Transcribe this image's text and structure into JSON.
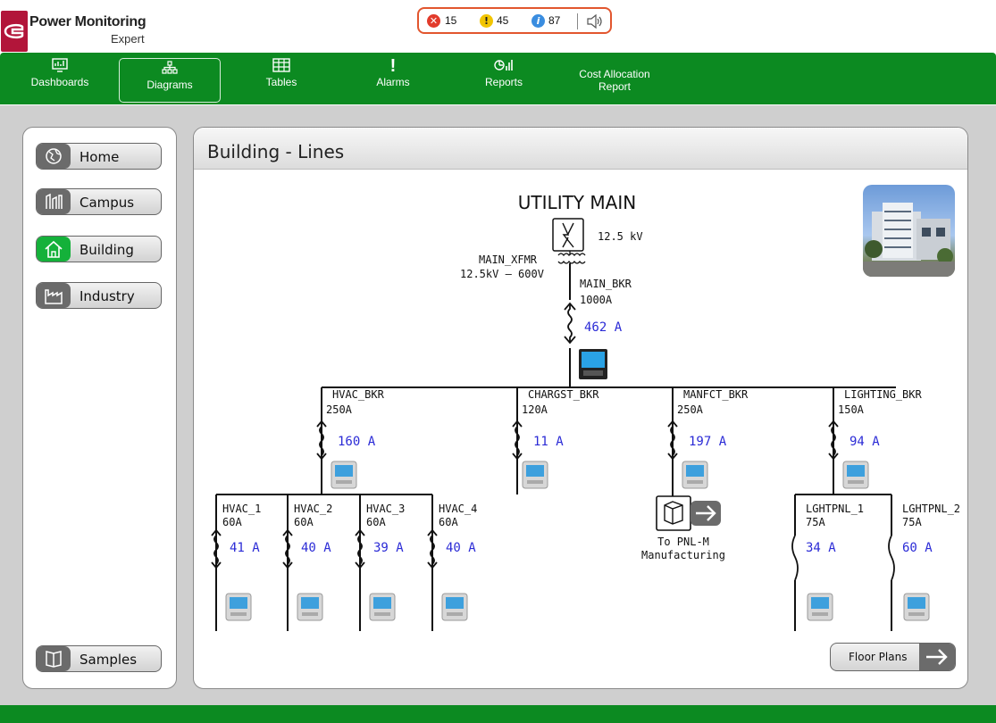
{
  "app": {
    "title": "Power Monitoring",
    "subtitle": "Expert"
  },
  "alarms": {
    "critical": "15",
    "warning": "45",
    "info": "87"
  },
  "nav": {
    "items": [
      {
        "label": "Dashboards",
        "icon": "dashboard-icon"
      },
      {
        "label": "Diagrams",
        "icon": "diagram-icon"
      },
      {
        "label": "Tables",
        "icon": "table-icon"
      },
      {
        "label": "Alarms",
        "icon": "alarm-icon"
      },
      {
        "label": "Reports",
        "icon": "report-icon"
      },
      {
        "label": "Cost Allocation",
        "label2": "Report"
      }
    ]
  },
  "sidebar": {
    "items": [
      {
        "label": "Home",
        "icon": "globe-icon"
      },
      {
        "label": "Campus",
        "icon": "campus-icon"
      },
      {
        "label": "Building",
        "icon": "building-icon",
        "active": true
      },
      {
        "label": "Industry",
        "icon": "factory-icon"
      }
    ],
    "samples": "Samples"
  },
  "page": {
    "title": "Building - Lines"
  },
  "diagram": {
    "utility": "UTILITY MAIN",
    "voltage": "12.5 kV",
    "xfmr_name": "MAIN_XFMR",
    "xfmr_rating": "12.5kV – 600V",
    "main_bkr": "MAIN_BKR",
    "main_bkr_rating": "1000A",
    "main_current": "462 A",
    "feeders": [
      {
        "name": "HVAC_BKR",
        "rating": "250A",
        "current": "160 A"
      },
      {
        "name": "CHARGST_BKR",
        "rating": "120A",
        "current": "11 A"
      },
      {
        "name": "MANFCT_BKR",
        "rating": "250A",
        "current": "197 A"
      },
      {
        "name": "LIGHTING_BKR",
        "rating": "150A",
        "current": "94 A"
      }
    ],
    "hvac_branches": [
      {
        "name": "HVAC_1",
        "rating": "60A",
        "current": "41 A"
      },
      {
        "name": "HVAC_2",
        "rating": "60A",
        "current": "40 A"
      },
      {
        "name": "HVAC_3",
        "rating": "60A",
        "current": "39 A"
      },
      {
        "name": "HVAC_4",
        "rating": "60A",
        "current": "40 A"
      }
    ],
    "lighting_branches": [
      {
        "name": "LGHTPNL_1",
        "rating": "75A",
        "current": "34 A"
      },
      {
        "name": "LGHTPNL_2",
        "rating": "75A",
        "current": "60 A"
      }
    ],
    "link_line1": "To PNL-M",
    "link_line2": "Manufacturing"
  },
  "floor_plans": "Floor Plans",
  "colors": {
    "brand_green": "#0c8a21",
    "brand_red": "#b2153a",
    "current_blue": "#2b2bd6",
    "active_green": "#14b13a"
  }
}
